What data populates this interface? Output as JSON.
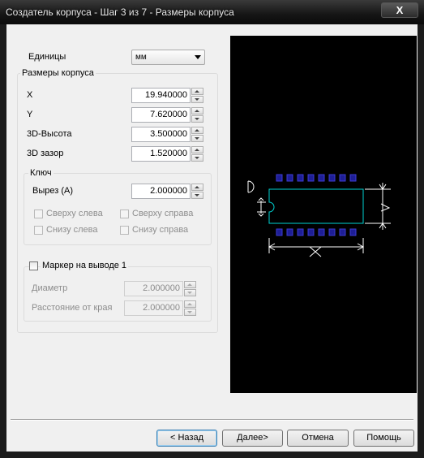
{
  "window": {
    "title": "Создатель корпуса - Шаг 3 из 7 - Размеры корпуса",
    "close_label": "X"
  },
  "units": {
    "label": "Единицы",
    "value": "мм"
  },
  "dimensions": {
    "title": "Размеры корпуса",
    "x": {
      "label": "X",
      "value": "19.940000"
    },
    "y": {
      "label": "Y",
      "value": "7.620000"
    },
    "height3d": {
      "label": "3D-Высота",
      "value": "3.500000"
    },
    "gap3d": {
      "label": "3D зазор",
      "value": "1.520000"
    }
  },
  "key": {
    "title": "Ключ",
    "notch": {
      "label": "Вырез (А)",
      "value": "2.000000"
    },
    "top_left": "Сверху слева",
    "top_right": "Сверху справа",
    "bottom_left": "Снизу слева",
    "bottom_right": "Снизу справа"
  },
  "pin_marker": {
    "label": "Маркер на выводе 1",
    "diameter": {
      "label": "Диаметр",
      "value": "2.000000"
    },
    "edge_distance": {
      "label": "Расстояние от края",
      "value": "2.000000"
    }
  },
  "buttons": {
    "back": "< Назад",
    "next": "Далее>",
    "cancel": "Отмена",
    "help": "Помощь"
  },
  "preview": {
    "outline_color": "#00d2d2",
    "pad_color": "#1e1e96",
    "dimension_color": "#ffffff"
  }
}
